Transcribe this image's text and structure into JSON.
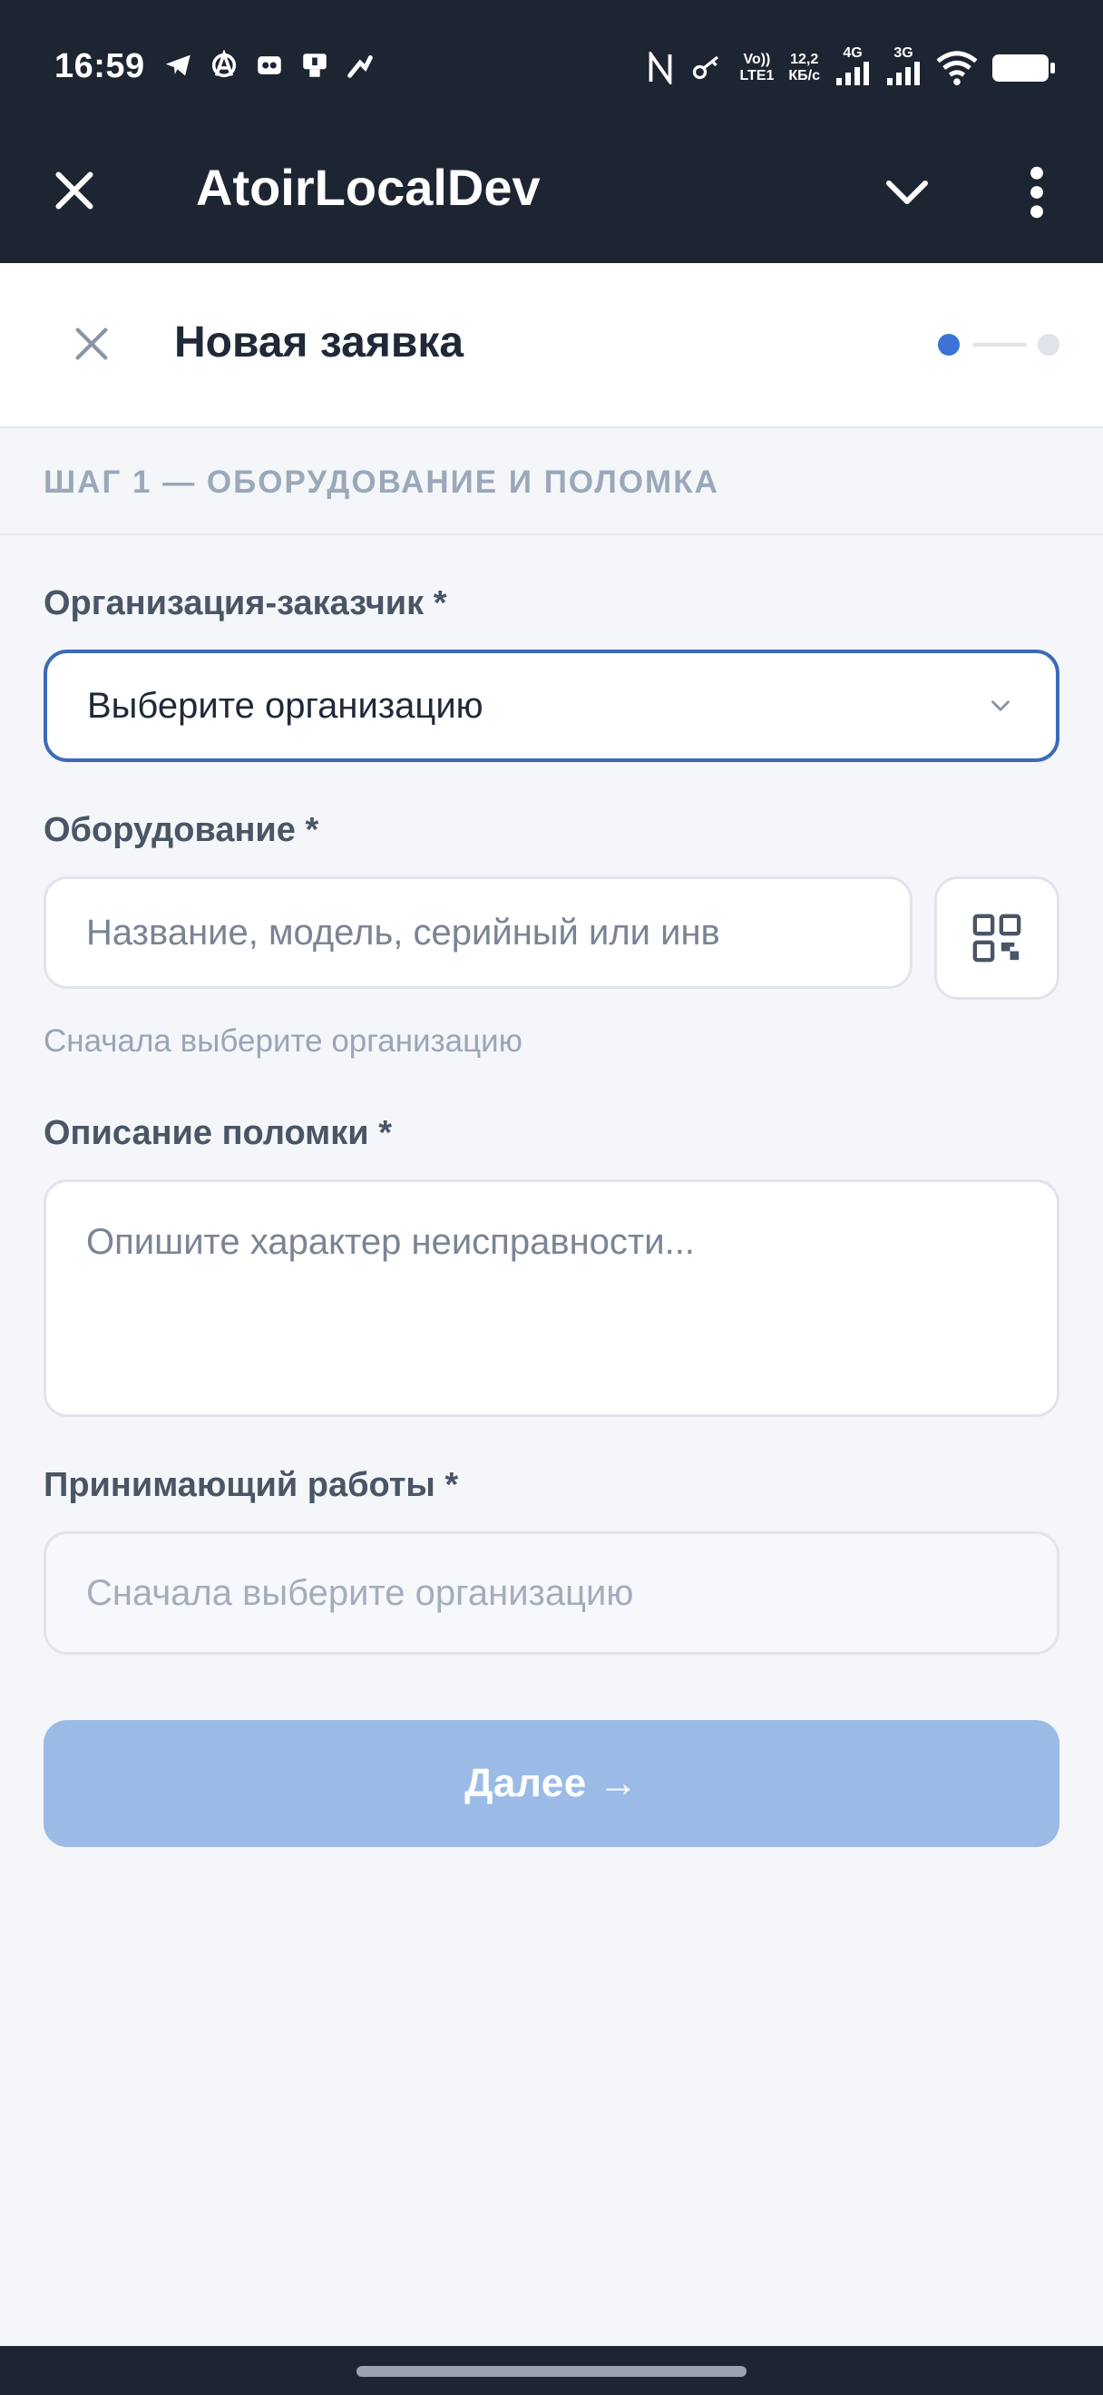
{
  "status_bar": {
    "time": "16:59",
    "network_label_1_top": "Vo))",
    "network_label_1_bottom": "LTE1",
    "speed_top": "12,2",
    "speed_bottom": "КБ/с",
    "signal_1": "4G",
    "signal_2": "3G"
  },
  "app_bar": {
    "title": "AtoirLocalDev"
  },
  "header": {
    "title": "Новая заявка",
    "step_current": 1,
    "step_total": 2
  },
  "section": {
    "title": "ШАГ 1 — ОБОРУДОВАНИЕ И ПОЛОМКА"
  },
  "form": {
    "organization": {
      "label": "Организация-заказчик *",
      "value": "Выберите организацию"
    },
    "equipment": {
      "label": "Оборудование *",
      "placeholder": "Название, модель, серийный или инв",
      "hint": "Сначала выберите организацию"
    },
    "description": {
      "label": "Описание поломки *",
      "placeholder": "Опишите характер неисправности..."
    },
    "receiver": {
      "label": "Принимающий работы *",
      "placeholder": "Сначала выберите организацию"
    },
    "next_label": "Далее →"
  },
  "colors": {
    "dark": "#1e2532",
    "accent": "#3b74d4",
    "button_disabled": "#9bbbe6"
  }
}
